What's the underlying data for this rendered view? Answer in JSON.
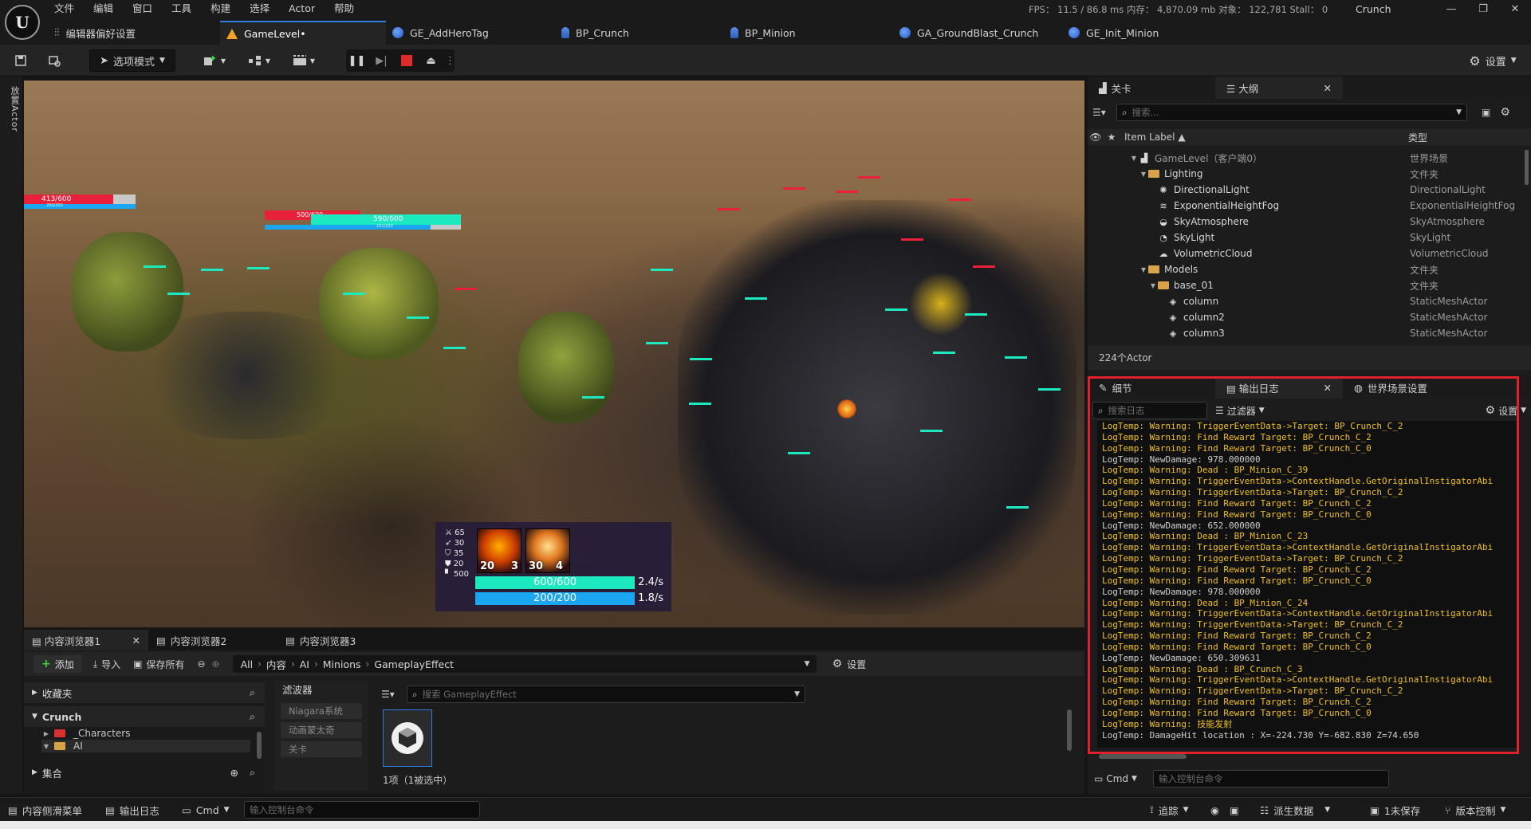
{
  "app": {
    "logo_text": "U",
    "menu": [
      "文件",
      "编辑",
      "窗口",
      "工具",
      "构建",
      "选择",
      "Actor",
      "帮助"
    ],
    "stats": "FPS： 11.5  / 86.8 ms   内存：  4,870.09 mb   对象：  122,781   Stall：  0",
    "project_name": "Crunch",
    "window_controls": [
      "—",
      "❐",
      "✕"
    ]
  },
  "doc_tabs": [
    {
      "label": "编辑器偏好设置"
    },
    {
      "label": "GameLevel•"
    },
    {
      "label": "GE_AddHeroTag"
    },
    {
      "label": "BP_Crunch"
    },
    {
      "label": "BP_Minion"
    },
    {
      "label": "GA_GroundBlast_Crunch"
    },
    {
      "label": "GE_Init_Minion"
    }
  ],
  "toolbar": {
    "select_mode": "选项模式",
    "settings": "设置"
  },
  "left_strip_label": "放置Actor",
  "viewport": {
    "hero_bar": {
      "hp": "413/600",
      "mp": "200/200"
    },
    "enemy_bar": {
      "hp_back": "500/600",
      "hp": "590/600",
      "mp": "161/200"
    }
  },
  "hud": {
    "stats": [
      {
        "icon": "sword-icon",
        "value": "65"
      },
      {
        "icon": "attack-speed-icon",
        "value": "30"
      },
      {
        "icon": "armor-icon",
        "value": "35"
      },
      {
        "icon": "magic-resist-icon",
        "value": "20"
      },
      {
        "icon": "move-speed-icon",
        "value": "500"
      }
    ],
    "skills": [
      {
        "level": "20",
        "cost": "3"
      },
      {
        "level": "30",
        "cost": "4"
      }
    ],
    "health": {
      "label": "600/600",
      "rate": "2.4/s",
      "fill": 1.0,
      "color": "#1de9c0"
    },
    "mana": {
      "label": "200/200",
      "rate": "1.8/s",
      "fill": 1.0,
      "color": "#1aa6f0"
    }
  },
  "outliner": {
    "tabs": [
      "关卡",
      "大纲"
    ],
    "search_placeholder": "搜索...",
    "col_label": "Item Label",
    "col_type": "类型",
    "rows": [
      {
        "label": "GameLevel（客户端0）",
        "type": "世界场景",
        "indent": 0,
        "kind": "level",
        "arrow": "▼",
        "dim": true
      },
      {
        "label": "Lighting",
        "type": "文件夹",
        "indent": 1,
        "kind": "folder",
        "arrow": "▼"
      },
      {
        "label": "DirectionalLight",
        "type": "DirectionalLight",
        "indent": 2,
        "kind": "sun"
      },
      {
        "label": "ExponentialHeightFog",
        "type": "ExponentialHeightFog",
        "indent": 2,
        "kind": "fog"
      },
      {
        "label": "SkyAtmosphere",
        "type": "SkyAtmosphere",
        "indent": 2,
        "kind": "sky"
      },
      {
        "label": "SkyLight",
        "type": "SkyLight",
        "indent": 2,
        "kind": "skylight"
      },
      {
        "label": "VolumetricCloud",
        "type": "VolumetricCloud",
        "indent": 2,
        "kind": "cloud"
      },
      {
        "label": "Models",
        "type": "文件夹",
        "indent": 1,
        "kind": "folder",
        "arrow": "▼"
      },
      {
        "label": "base_01",
        "type": "文件夹",
        "indent": 2,
        "kind": "folder",
        "arrow": "▼"
      },
      {
        "label": "column",
        "type": "StaticMeshActor",
        "indent": 3,
        "kind": "mesh"
      },
      {
        "label": "column2",
        "type": "StaticMeshActor",
        "indent": 3,
        "kind": "mesh"
      },
      {
        "label": "column3",
        "type": "StaticMeshActor",
        "indent": 3,
        "kind": "mesh"
      }
    ],
    "actor_count": "224个Actor"
  },
  "log_panel": {
    "tabs": [
      "细节",
      "输出日志",
      "世界场景设置"
    ],
    "search_placeholder": "搜索日志",
    "filter": "过滤器",
    "settings": "设置",
    "lines": [
      {
        "t": "LogTemp: Warning: TriggerEventData->Target: BP_Crunch_C_2",
        "w": true
      },
      {
        "t": "LogTemp: Warning: Find Reward Target: BP_Crunch_C_2",
        "w": true
      },
      {
        "t": "LogTemp: Warning: Find Reward Target: BP_Crunch_C_0",
        "w": true
      },
      {
        "t": "LogTemp: NewDamage: 978.000000",
        "w": false
      },
      {
        "t": "LogTemp: Warning: Dead : BP_Minion_C_39",
        "w": true
      },
      {
        "t": "LogTemp: Warning: TriggerEventData->ContextHandle.GetOriginalInstigatorAbi",
        "w": true
      },
      {
        "t": "LogTemp: Warning: TriggerEventData->Target: BP_Crunch_C_2",
        "w": true
      },
      {
        "t": "LogTemp: Warning: Find Reward Target: BP_Crunch_C_2",
        "w": true
      },
      {
        "t": "LogTemp: Warning: Find Reward Target: BP_Crunch_C_0",
        "w": true
      },
      {
        "t": "LogTemp: NewDamage: 652.000000",
        "w": false
      },
      {
        "t": "LogTemp: Warning: Dead : BP_Minion_C_23",
        "w": true
      },
      {
        "t": "LogTemp: Warning: TriggerEventData->ContextHandle.GetOriginalInstigatorAbi",
        "w": true
      },
      {
        "t": "LogTemp: Warning: TriggerEventData->Target: BP_Crunch_C_2",
        "w": true
      },
      {
        "t": "LogTemp: Warning: Find Reward Target: BP_Crunch_C_2",
        "w": true
      },
      {
        "t": "LogTemp: Warning: Find Reward Target: BP_Crunch_C_0",
        "w": true
      },
      {
        "t": "LogTemp: NewDamage: 978.000000",
        "w": false
      },
      {
        "t": "LogTemp: Warning: Dead : BP_Minion_C_24",
        "w": true
      },
      {
        "t": "LogTemp: Warning: TriggerEventData->ContextHandle.GetOriginalInstigatorAbi",
        "w": true
      },
      {
        "t": "LogTemp: Warning: TriggerEventData->Target: BP_Crunch_C_2",
        "w": true
      },
      {
        "t": "LogTemp: Warning: Find Reward Target: BP_Crunch_C_2",
        "w": true
      },
      {
        "t": "LogTemp: Warning: Find Reward Target: BP_Crunch_C_0",
        "w": true
      },
      {
        "t": "LogTemp: NewDamage: 650.309631",
        "w": false
      },
      {
        "t": "LogTemp: Warning: Dead : BP_Crunch_C_3",
        "w": true
      },
      {
        "t": "LogTemp: Warning: TriggerEventData->ContextHandle.GetOriginalInstigatorAbi",
        "w": true
      },
      {
        "t": "LogTemp: Warning: TriggerEventData->Target: BP_Crunch_C_2",
        "w": true
      },
      {
        "t": "LogTemp: Warning: Find Reward Target: BP_Crunch_C_2",
        "w": true
      },
      {
        "t": "LogTemp: Warning: Find Reward Target: BP_Crunch_C_0",
        "w": true
      },
      {
        "t": "LogTemp: Warning: 技能发射",
        "w": true
      },
      {
        "t": "LogTemp: DamageHit location : X=-224.730 Y=-682.830 Z=74.650",
        "w": false
      }
    ],
    "cmd_label": "Cmd",
    "cmd_placeholder": "输入控制台命令"
  },
  "content_browser": {
    "tabs": [
      "内容浏览器1",
      "内容浏览器2",
      "内容浏览器3"
    ],
    "add": "添加",
    "import": "导入",
    "save_all": "保存所有",
    "breadcrumb": [
      "All",
      "内容",
      "AI",
      "Minions",
      "GameplayEffect"
    ],
    "settings": "设置",
    "favorites": "收藏夹",
    "project": "Crunch",
    "tree": [
      "_Characters",
      "AI"
    ],
    "collections": "集合",
    "filters_title": "滤波器",
    "filters": [
      "Niagara系统",
      "动画蒙太奇",
      "关卡"
    ],
    "search_placeholder": "搜索 GameplayEffect",
    "item_count": "1项（1被选中）"
  },
  "statusbar": {
    "content_drawer": "内容侧滑菜单",
    "output_log": "输出日志",
    "cmd": "Cmd",
    "cmd_placeholder": "输入控制台命令",
    "trace": "追踪",
    "derived_data": "派生数据",
    "unsaved": "1未保存",
    "source_control": "版本控制"
  }
}
